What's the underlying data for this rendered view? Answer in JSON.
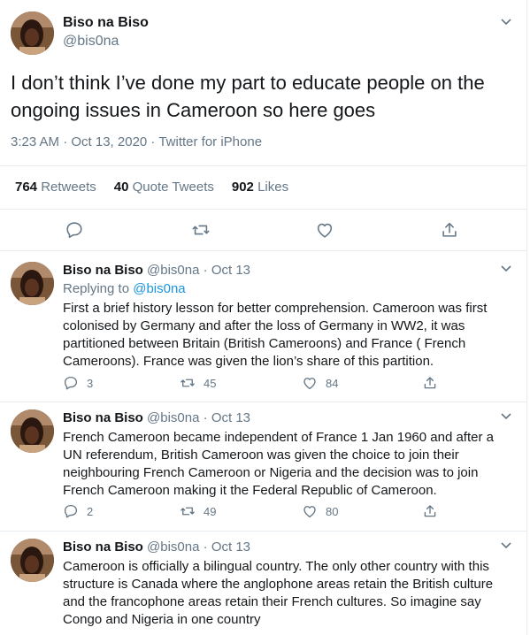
{
  "main_tweet": {
    "author_name": "Biso na Biso",
    "author_handle": "@bis0na",
    "text": "I don’t think I’ve done my part to educate people on the ongoing issues in Cameroon so here goes",
    "meta": "3:23 AM · Oct 13, 2020 · Twitter for iPhone",
    "stats": {
      "retweets_count": "764",
      "retweets_label": "Retweets",
      "quotes_count": "40",
      "quotes_label": "Quote Tweets",
      "likes_count": "902",
      "likes_label": "Likes"
    },
    "actions": [
      "reply-icon",
      "retweet-icon",
      "like-icon",
      "share-icon"
    ]
  },
  "replies": [
    {
      "author_name": "Biso na Biso",
      "author_handle": "@bis0na",
      "separator": "·",
      "date": "Oct 13",
      "replying_prefix": "Replying to",
      "replying_handle": "@bis0na",
      "text": "First a brief history lesson for better comprehension. Cameroon was first colonised by Germany and after the loss of Germany in WW2, it was partitioned between Britain (British Cameroons) and France ( French Cameroons). France was given the lion’s share of this partition.",
      "reply_count": "3",
      "retweet_count": "45",
      "like_count": "84"
    },
    {
      "author_name": "Biso na Biso",
      "author_handle": "@bis0na",
      "separator": "·",
      "date": "Oct 13",
      "text": "French Cameroon became independent of France 1 Jan 1960 and after a UN referendum, British Cameroon was given the choice to join their neighbouring French Cameroon or Nigeria and the decision was to join French Cameroon making it the Federal Republic of Cameroon.",
      "reply_count": "2",
      "retweet_count": "49",
      "like_count": "80"
    },
    {
      "author_name": "Biso na Biso",
      "author_handle": "@bis0na",
      "separator": "·",
      "date": "Oct 13",
      "text": "Cameroon is officially a bilingual country. The only other country with this structure is Canada where the anglophone areas retain the British culture and the francophone areas retain their French cultures. So imagine say Congo and Nigeria in one country"
    }
  ],
  "colors": {
    "accent": "#1b95e0",
    "muted": "#657786",
    "text": "#14171a",
    "border": "#e6ecf0"
  }
}
